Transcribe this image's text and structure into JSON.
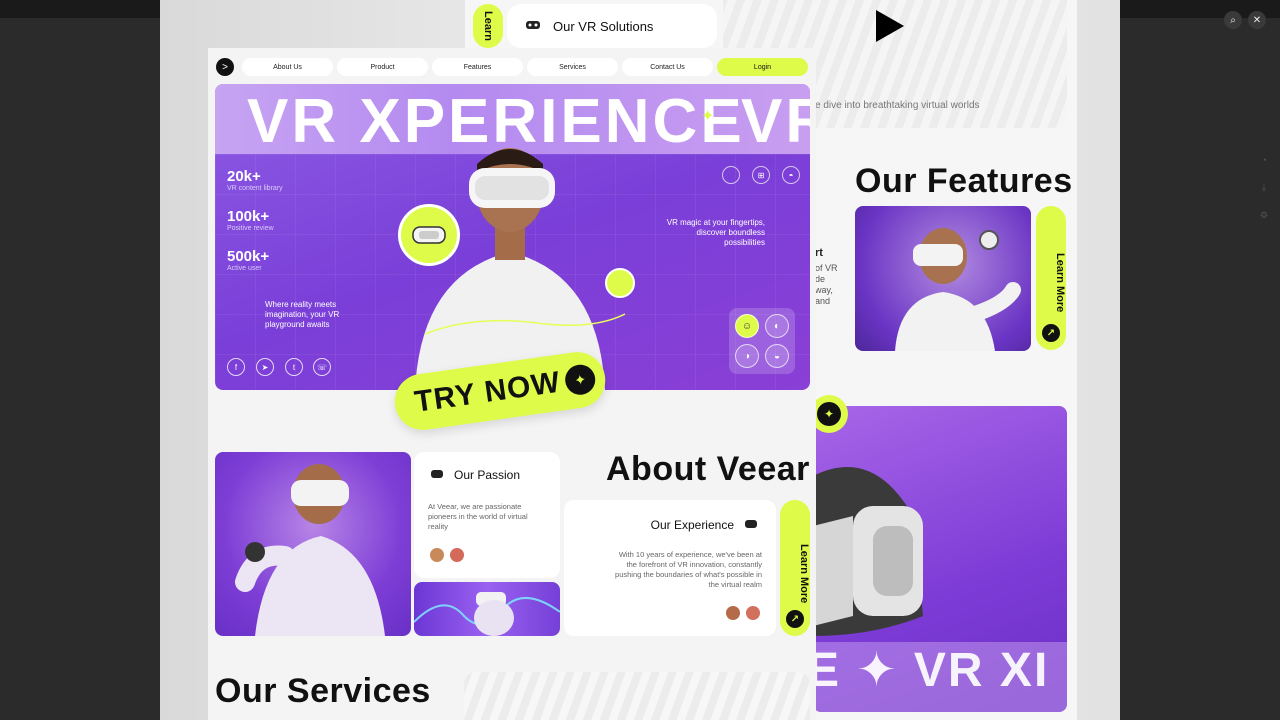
{
  "viewer": {
    "zoom_icon": "zoom-in-icon",
    "close_icon": "close-icon"
  },
  "nav": {
    "logo_glyph": ">",
    "items": [
      "About Us",
      "Product",
      "Features",
      "Services",
      "Contact Us"
    ],
    "login": "Login"
  },
  "hero": {
    "title": "VR XPERIENCE",
    "title_repeat": "VR",
    "stats": [
      {
        "value": "20k+",
        "label": "VR content library"
      },
      {
        "value": "100k+",
        "label": "Positive review"
      },
      {
        "value": "500k+",
        "label": "Active user"
      }
    ],
    "tagline": "Where reality meets imagination, your VR playground awaits",
    "right_text": "VR magic at your fingertips, discover boundless possibilities",
    "platform_icons": [
      "apple-icon",
      "windows-icon",
      "android-icon"
    ],
    "social_icons": [
      "facebook-icon",
      "telegram-icon",
      "twitter-icon",
      "whatsapp-icon"
    ],
    "cta": "TRY NOW"
  },
  "about": {
    "title": "About Veear",
    "passion_title": "Our Passion",
    "passion_text": "At Veear, we are passionate pioneers in the world of virtual reality",
    "experience_title": "Our Experience",
    "experience_text": "With 10 years of experience, we've been at the forefront of VR innovation, constantly pushing the boundaries of what's possible in the virtual realm",
    "learn_more": "Learn More"
  },
  "services": {
    "title": "Our Services"
  },
  "back": {
    "tab_label": "Learn",
    "solutions_title": "Our VR Solutions",
    "caption": "e dive into breathtaking virtual worlds",
    "features_title": "Our Features",
    "learn_more": "Learn More",
    "fragment_lines": [
      "rt",
      "of VR",
      "de",
      "way,",
      "and"
    ],
    "hero_text": "E  ✦  VR XI"
  },
  "colors": {
    "accent": "#dffb4a",
    "purple": "#7a3fd8",
    "dark": "#111111"
  }
}
